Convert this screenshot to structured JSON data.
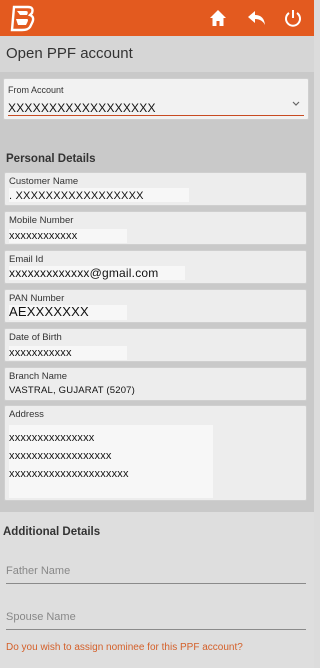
{
  "colors": {
    "brand": "#e35a1f",
    "accent": "#d4602a",
    "field_bg": "#ededed"
  },
  "header": {
    "logo": "bank-of-baroda-logo",
    "icons": [
      "home-icon",
      "back-icon",
      "power-icon"
    ]
  },
  "page": {
    "title": "Open PPF account"
  },
  "from_account": {
    "label": "From Account",
    "value": "XXXXXXXXXXXXXXXXXX"
  },
  "personal": {
    "heading": "Personal Details",
    "customer_name_label": "Customer Name",
    "customer_name": ". XXXXXXXXXXXXXXXXX",
    "mobile_label": "Mobile Number",
    "mobile": "xxxxxxxxxxxx",
    "email_label": "Email Id",
    "email": "xxxxxxxxxxxxx@gmail.com",
    "pan_label": "PAN Number",
    "pan": "AEXXXXXXX",
    "dob_label": "Date of Birth",
    "dob": "xxxxxxxxxxx",
    "branch_label": "Branch Name",
    "branch": "VASTRAL, GUJARAT (5207)",
    "address_label": "Address",
    "address_lines": [
      "xxxxxxxxxxxxxxx",
      "xxxxxxxxxxxxxxxxxx",
      "xxxxxxxxxxxxxxxxxxxxx"
    ]
  },
  "additional": {
    "heading": "Additional Details",
    "father_placeholder": "Father Name",
    "spouse_placeholder": "Spouse Name"
  },
  "nominee_question": "Do you wish to assign nominee for this PPF account?"
}
